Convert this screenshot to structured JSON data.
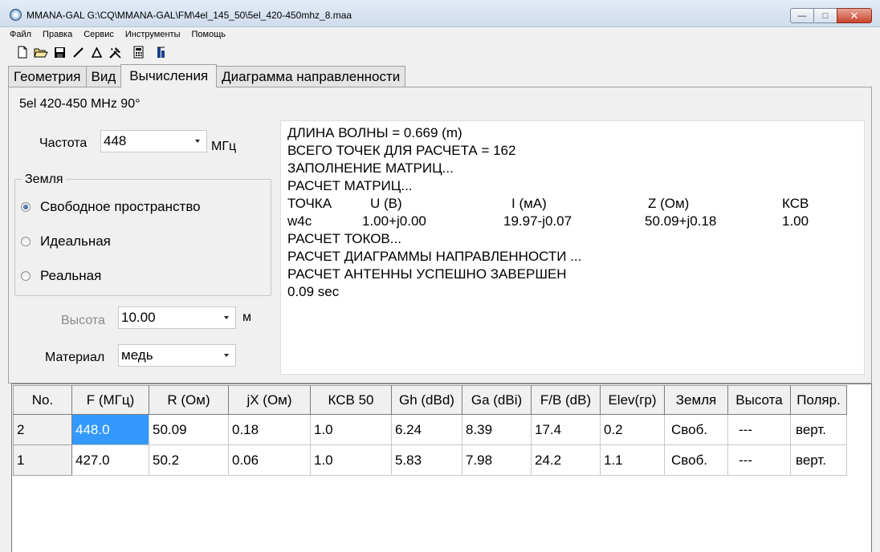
{
  "window": {
    "title": "MMANA-GAL G:\\CQ\\MMANA-GAL\\FM\\4el_145_50\\5el_420-450mhz_8.maa"
  },
  "menu": [
    "Файл",
    "Правка",
    "Сервис",
    "Инструменты",
    "Помощь"
  ],
  "toolbar": [
    "new-file-icon",
    "open-folder-icon",
    "save-icon",
    "line-icon",
    "triangle-icon",
    "tools-icon",
    "calculator-icon",
    "chart-icon"
  ],
  "tabs": [
    "Геометрия",
    "Вид",
    "Вычисления",
    "Диаграмма направленности"
  ],
  "active_tab": "Вычисления",
  "project_title": "5el  420-450 MHz 90°",
  "frequency": {
    "label": "Частота",
    "value": "448",
    "unit": "МГц"
  },
  "ground": {
    "title": "Земля",
    "options": [
      "Свободное пространство",
      "Идеальная",
      "Реальная"
    ],
    "selected": "Свободное пространство"
  },
  "height": {
    "label": "Высота",
    "value": "10.00",
    "unit": "м"
  },
  "material": {
    "label": "Материал",
    "value": "медь"
  },
  "output": {
    "lines_top": [
      "ДЛИНА ВОЛНЫ = 0.669 (m)",
      "ВСЕГО ТОЧЕК ДЛЯ РАСЧЕТА = 162",
      "ЗАПОЛНЕНИЕ МАТРИЦ...",
      "РАСЧЕТ МАТРИЦ..."
    ],
    "header": [
      "ТОЧКА",
      "U (В)",
      "I (мА)",
      "Z (Ом)",
      "КСВ"
    ],
    "row": [
      "w4c",
      "1.00+j0.00",
      "19.97-j0.07",
      "50.09+j0.18",
      "1.00"
    ],
    "lines_bottom": [
      "РАСЧЕТ ТОКОВ...",
      "РАСЧЕТ ДИАГРАММЫ НАПРАВЛЕННОСТИ ...",
      "РАСЧЕТ АНТЕННЫ УСПЕШНО ЗАВЕРШЕН",
      "0.09 sec"
    ]
  },
  "grid": {
    "columns": [
      "No.",
      "F (МГц)",
      "R (Ом)",
      "jX (Ом)",
      "КСВ 50",
      "Gh (dBd)",
      "Ga (dBi)",
      "F/B (dB)",
      "Elev(гр)",
      "Земля",
      "Высота",
      "Поляр."
    ],
    "rows": [
      [
        "2",
        "448.0",
        "50.09",
        "0.18",
        "1.0",
        "6.24",
        "8.39",
        "17.4",
        "0.2",
        "Своб.",
        "---",
        "верт."
      ],
      [
        "1",
        "427.0",
        "50.2",
        "0.06",
        "1.0",
        "5.83",
        "7.98",
        "24.2",
        "1.1",
        "Своб.",
        "---",
        "верт."
      ]
    ]
  }
}
